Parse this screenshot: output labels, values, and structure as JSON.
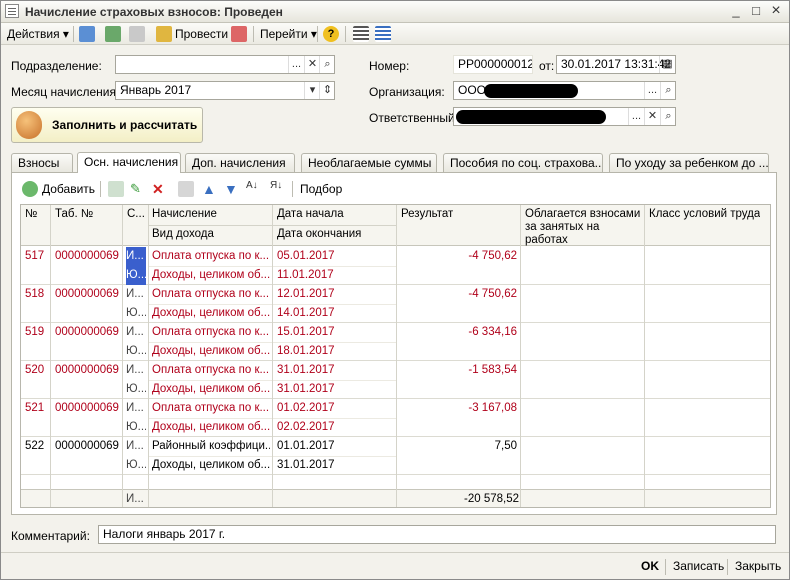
{
  "window": {
    "title": "Начисление страховых взносов: Проведен",
    "minimize": "_",
    "maximize": "□",
    "close": "×"
  },
  "toolbar": {
    "actions": "Действия ▾",
    "post": "Провести",
    "goto": "Перейти ▾",
    "help": "?"
  },
  "form": {
    "department_label": "Подразделение:",
    "department_value": "",
    "month_label": "Месяц начисления:",
    "month_value": "Январь 2017",
    "number_label": "Номер:",
    "number_value": "РР000000012",
    "date_label": "от:",
    "date_value": "30.01.2017 13:31:42",
    "org_label": "Организация:",
    "org_value": "ООО",
    "resp_label": "Ответственный:",
    "resp_value": "",
    "fill_button": "Заполнить и рассчитать",
    "comment_label": "Комментарий:",
    "comment_value": "Налоги январь 2017  г."
  },
  "tabs": [
    "Взносы",
    "Осн. начисления",
    "Доп. начисления",
    "Необлагаемые суммы",
    "Пособия по соц. страхова...",
    "По уходу за ребенком до ..."
  ],
  "panel_toolbar": {
    "add": "Добавить",
    "select": "Подбор"
  },
  "columns": {
    "num": "№",
    "tab": "Таб. №",
    "s": "С...",
    "accrual": "Начисление",
    "income": "Вид дохода",
    "date_start": "Дата начала",
    "date_end": "Дата окончания",
    "result": "Результат",
    "taxed": "Облагается взносами за занятых на работах",
    "class": "Класс условий труда"
  },
  "rows": [
    {
      "num": "517",
      "tab": "0000000069",
      "s1": "И...",
      "s2": "Ю...",
      "accrual": "Оплата отпуска по к...",
      "income": "Доходы, целиком об...",
      "start": "05.01.2017",
      "end": "11.01.2017",
      "result": "-4 750,62",
      "red": true
    },
    {
      "num": "518",
      "tab": "0000000069",
      "s1": "И...",
      "s2": "Ю...",
      "accrual": "Оплата отпуска по к...",
      "income": "Доходы, целиком об...",
      "start": "12.01.2017",
      "end": "14.01.2017",
      "result": "-4 750,62",
      "red": true
    },
    {
      "num": "519",
      "tab": "0000000069",
      "s1": "И...",
      "s2": "Ю...",
      "accrual": "Оплата отпуска по к...",
      "income": "Доходы, целиком об...",
      "start": "15.01.2017",
      "end": "18.01.2017",
      "result": "-6 334,16",
      "red": true
    },
    {
      "num": "520",
      "tab": "0000000069",
      "s1": "И...",
      "s2": "Ю...",
      "accrual": "Оплата отпуска по к...",
      "income": "Доходы, целиком об...",
      "start": "31.01.2017",
      "end": "31.01.2017",
      "result": "-1 583,54",
      "red": true
    },
    {
      "num": "521",
      "tab": "0000000069",
      "s1": "И...",
      "s2": "Ю...",
      "accrual": "Оплата отпуска по к...",
      "income": "Доходы, целиком об...",
      "start": "01.02.2017",
      "end": "02.02.2017",
      "result": "-3 167,08",
      "red": true
    },
    {
      "num": "522",
      "tab": "0000000069",
      "s1": "И...",
      "s2": "Ю...",
      "accrual": "Районный коэффици...",
      "income": "Доходы, целиком об...",
      "start": "01.01.2017",
      "end": "31.01.2017",
      "result": "7,50",
      "red": false
    }
  ],
  "footer": {
    "s": "И...",
    "total": "-20 578,52"
  },
  "bottom": {
    "ok": "OK",
    "save": "Записать",
    "close": "Закрыть"
  },
  "colors": {
    "accent_red": "#b0001a",
    "selection": "#3a5fcd"
  }
}
